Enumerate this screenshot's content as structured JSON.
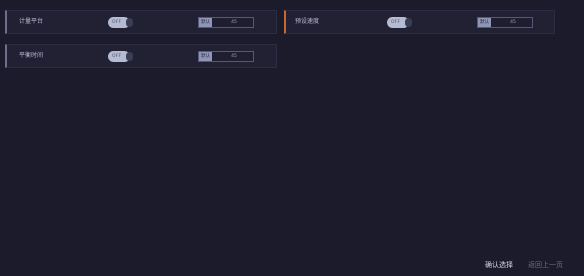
{
  "settings": [
    {
      "label": "计量平台",
      "toggle_text": "OFF",
      "field_tag": "默认",
      "field_value": "45",
      "accent": "#6f6e8e"
    },
    {
      "label": "预设速度",
      "toggle_text": "OFF",
      "field_tag": "默认",
      "field_value": "45",
      "accent": "#c46a2c"
    },
    {
      "label": "平衡时间",
      "toggle_text": "OFF",
      "field_tag": "默认",
      "field_value": "45",
      "accent": "#6f6e8e"
    }
  ],
  "footer": {
    "confirm_label": "确认选择",
    "back_label": "返回上一页"
  },
  "colors": {
    "background": "#1c1b2b",
    "card": "#222133",
    "toggle_track": "#b4bbd2"
  }
}
